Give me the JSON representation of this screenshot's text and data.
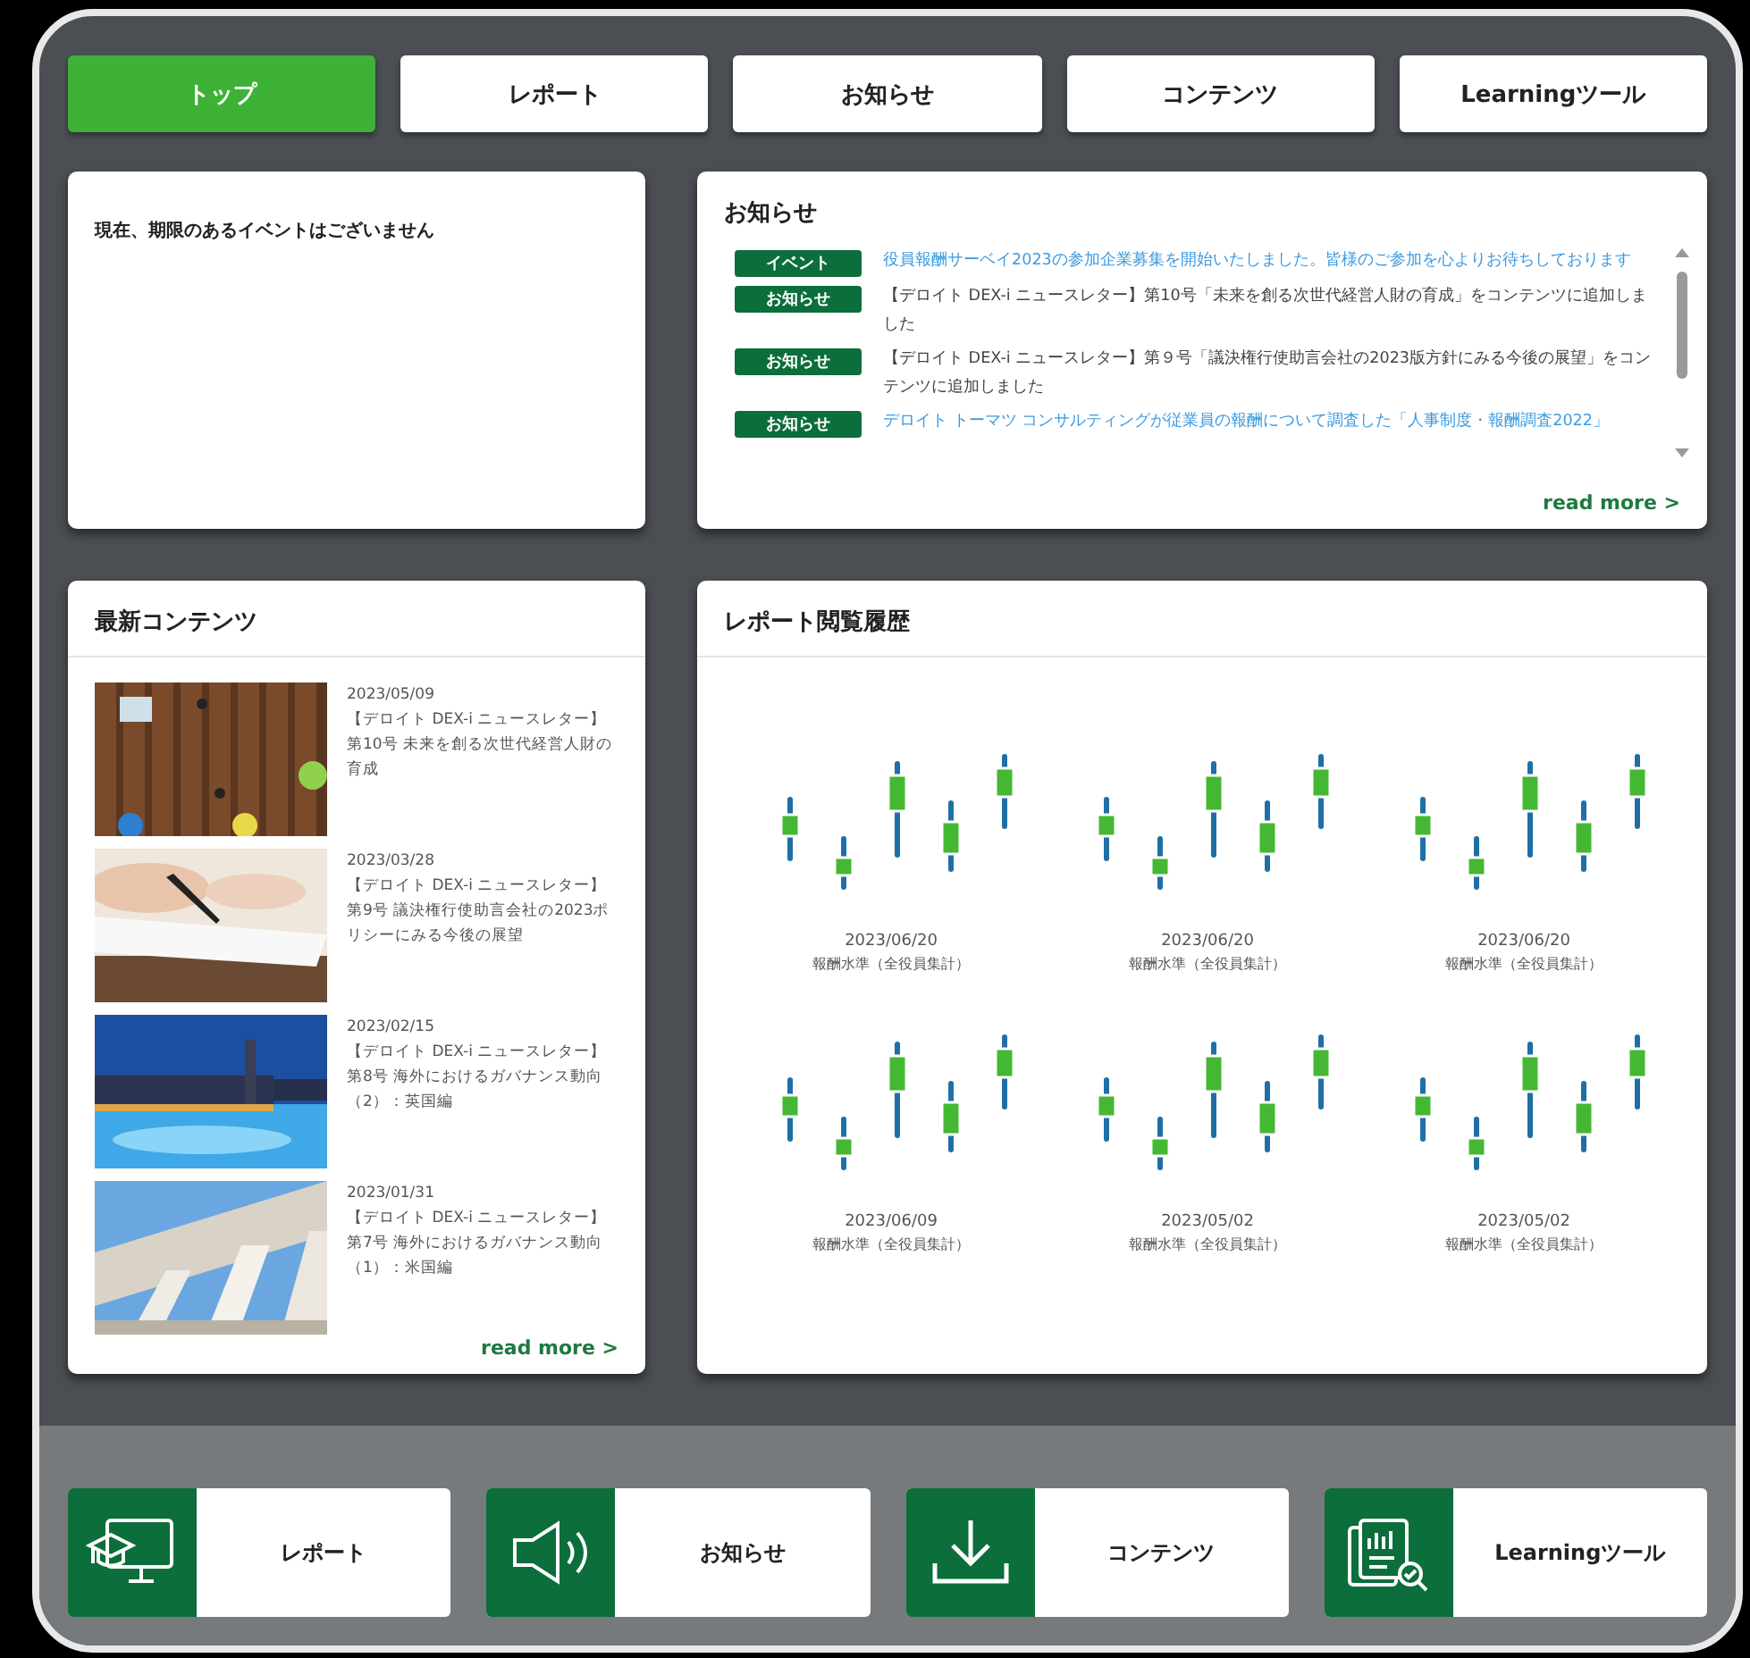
{
  "tabs": [
    {
      "label": "トップ",
      "selected": true
    },
    {
      "label": "レポート",
      "selected": false
    },
    {
      "label": "お知らせ",
      "selected": false
    },
    {
      "label": "コンテンツ",
      "selected": false
    },
    {
      "label": "Learningツール",
      "selected": false
    }
  ],
  "events": {
    "message": "現在、期限のあるイベントはございません"
  },
  "notices": {
    "title": "お知らせ",
    "items": [
      {
        "tag": "イベント",
        "text": "役員報酬サーベイ2023の参加企業募集を開始いたしました。皆様のご参加を心よりお待ちしております",
        "linked": true
      },
      {
        "tag": "お知らせ",
        "text": "【デロイト DEX-i ニュースレター】第10号「未来を創る次世代経営人財の育成」をコンテンツに追加しました",
        "linked": false
      },
      {
        "tag": "お知らせ",
        "text": "【デロイト DEX-i ニュースレター】第９号「議決権行使助言会社の2023版方針にみる今後の展望」をコンテンツに追加しました",
        "linked": false
      },
      {
        "tag": "お知らせ",
        "text": "デロイト トーマツ コンサルティングが従業員の報酬について調査した「人事制度・報酬調査2022」",
        "linked": true
      }
    ],
    "read_more": "read more >"
  },
  "contents": {
    "title": "最新コンテンツ",
    "items": [
      {
        "date": "2023/05/09",
        "series": "【デロイト DEX-i ニュースレター】",
        "title": "第10号 未来を創る次世代経営人財の育成",
        "kind": "picture"
      },
      {
        "date": "2023/03/28",
        "series": "【デロイト DEX-i ニュースレター】",
        "title": "第9号 議決権行使助言会社の2023ポリシーにみる今後の展望",
        "kind": "picture"
      },
      {
        "date": "2023/02/15",
        "series": "【デロイト DEX-i ニュースレター】",
        "title": "第8号 海外におけるガバナンス動向（2）：英国編",
        "kind": "picture"
      },
      {
        "date": "2023/01/31",
        "series": "【デロイト DEX-i ニュースレター】",
        "title": "第7号 海外におけるガバナンス動向（1）：米国編",
        "kind": "picture"
      }
    ],
    "read_more": "read more >"
  },
  "report_history": {
    "title": "レポート閲覧履歴",
    "items": [
      {
        "date": "2023/06/20",
        "caption": "報酬水準（全役員集計）"
      },
      {
        "date": "2023/06/20",
        "caption": "報酬水準（全役員集計）"
      },
      {
        "date": "2023/06/20",
        "caption": "報酬水準（全役員集計）"
      },
      {
        "date": "2023/06/09",
        "caption": "報酬水準（全役員集計）"
      },
      {
        "date": "2023/05/02",
        "caption": "報酬水準（全役員集計）"
      },
      {
        "date": "2023/05/02",
        "caption": "報酬水準（全役員集計）"
      }
    ]
  },
  "shortcuts": [
    {
      "kind": "report",
      "label": "レポート"
    },
    {
      "kind": "notice",
      "label": "お知らせ"
    },
    {
      "kind": "contents",
      "label": "コンテンツ"
    },
    {
      "kind": "learning",
      "label": "Learningツール"
    }
  ]
}
